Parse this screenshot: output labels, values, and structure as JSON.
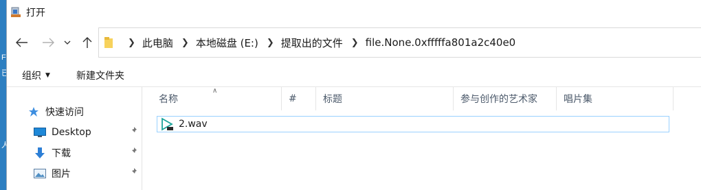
{
  "window": {
    "title": "打开"
  },
  "background": {
    "fragments": [
      "F",
      "已",
      "人"
    ]
  },
  "address": {
    "crumbs": [
      "此电脑",
      "本地磁盘 (E:)",
      "提取出的文件",
      "file.None.0xfffffa801a2c40e0"
    ]
  },
  "toolbar": {
    "organize": "组织",
    "new_folder": "新建文件夹"
  },
  "navpane": {
    "quick_access": "快速访问",
    "items": [
      "Desktop",
      "下载",
      "图片"
    ]
  },
  "columns": [
    "名称",
    "#",
    "标题",
    "参与创作的艺术家",
    "唱片集"
  ],
  "files": [
    {
      "name": "2.wav"
    }
  ],
  "colors": {
    "selection_border": "#99d1ff",
    "accent": "#0078d7"
  }
}
